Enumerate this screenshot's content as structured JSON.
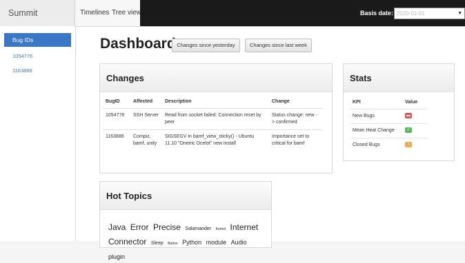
{
  "navbar": {
    "brand": "Summit Dashboard",
    "links": [
      "Timelines",
      "Tree view"
    ],
    "basis_label": "Basis date:",
    "basis_value": "2020-01-01",
    "dropdown_icon": "caret-down-icon"
  },
  "sidebar": {
    "heading": "Bug IDs",
    "items": [
      "1054776",
      "1163886"
    ]
  },
  "main": {
    "title": "Dashboard",
    "buttons": [
      "Changes since yesterday",
      "Changes since last week"
    ]
  },
  "changes": {
    "title": "Changes",
    "columns": [
      "BugID",
      "Affected",
      "Description",
      "Change"
    ],
    "rows": [
      {
        "bug_id": "1054776",
        "affected": "SSH Server",
        "description": "Read from socket failed: Connection reset by peer",
        "change": "Status change: new -> confirmed"
      },
      {
        "bug_id": "1163886",
        "affected": "Compiz, bamf, unity",
        "description": "SIGSEGV in bamf_view_sticky() - Ubuntu 11.10 \"Oneiric Ocelot\" new install",
        "change": "Importance set to critical for bamf"
      }
    ]
  },
  "stats": {
    "title": "Stats",
    "columns": [
      "KPI",
      "Value"
    ],
    "rows": [
      {
        "kpi": "New Bugs",
        "icon": "alert-badge-icon",
        "color": "#d9534f"
      },
      {
        "kpi": "Mean Heat Change",
        "icon": "check-badge-icon",
        "color": "#5cb85c"
      },
      {
        "kpi": "Closed Bugs",
        "icon": "warning-badge-icon",
        "color": "#f0ad4e"
      }
    ]
  },
  "hot_topics": {
    "title": "Hot Topics",
    "words": [
      {
        "text": "Java",
        "weight": 3
      },
      {
        "text": "Error",
        "weight": 3
      },
      {
        "text": "Precise",
        "weight": 3
      },
      {
        "text": "Salamander",
        "weight": 1
      },
      {
        "text": "Kernel",
        "weight": 0
      },
      {
        "text": "Internet",
        "weight": 3
      },
      {
        "text": "Connector",
        "weight": 3
      },
      {
        "text": "Sleep",
        "weight": 1
      },
      {
        "text": "Button",
        "weight": 0
      },
      {
        "text": "Python",
        "weight": 2
      },
      {
        "text": "module",
        "weight": 2
      },
      {
        "text": "Audio",
        "weight": 2
      },
      {
        "text": "plugin",
        "weight": 2
      }
    ]
  }
}
